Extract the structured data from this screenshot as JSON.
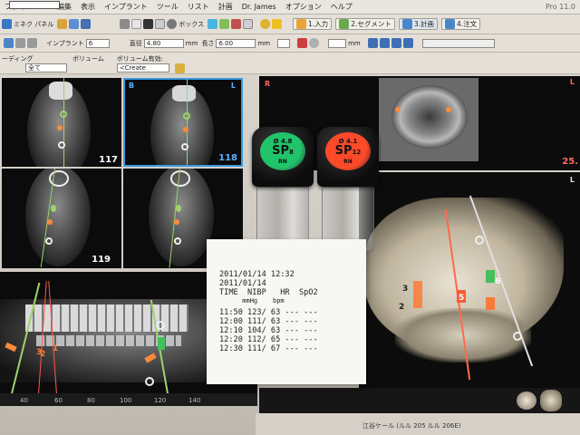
{
  "menu": {
    "window_title": "Pro 11.0",
    "items": [
      "ファイル",
      "編集",
      "表示",
      "インプラント",
      "ツール",
      "リスト",
      "計画",
      "Dr. James",
      "オプション",
      "ヘルプ"
    ]
  },
  "toolbar": {
    "mask_label": "ミネク パネル",
    "box_label": "ボックス",
    "implant_label": "インプラント",
    "implant_value": "6",
    "diameter_label": "直径",
    "diameter_value": "4.80",
    "diameter_unit": "mm",
    "length_label": "長さ",
    "length_value": "6.00",
    "length_unit": "mm",
    "mm_label": "mm",
    "steps": [
      {
        "num": "1.",
        "label": "入力"
      },
      {
        "num": "2.",
        "label": "セグメント"
      },
      {
        "num": "3.",
        "label": "計画"
      },
      {
        "num": "4.",
        "label": "注文"
      }
    ],
    "row3_label1": "ーディング",
    "row3_label2": "ボリューム",
    "row3_label3": "ボリューム有効:",
    "row3_select": "全て",
    "row3_create": "<Create"
  },
  "viewport": {
    "cross_labels": [
      "117",
      "118",
      "119"
    ],
    "tag_b": "B",
    "tag_l1": "L",
    "tag_l2": "L",
    "tag_r": "R",
    "tag_l3": "L",
    "axial_number": "25.",
    "tag_1": "1",
    "pano_numbers": [
      "3",
      "2",
      "1"
    ],
    "pano_markers": [
      "6",
      "5",
      "3",
      "2"
    ],
    "ruler_ticks": [
      "40",
      "60",
      "80",
      "100",
      "120",
      "140"
    ],
    "bottom_right_number": "-1"
  },
  "bottles": [
    {
      "line1": "Ø 4.8",
      "brand": "SP",
      "size": "8",
      "line3": "RN",
      "color": "#21c46a"
    },
    {
      "line1": "Ø 4.1",
      "brand": "SP",
      "size": "12",
      "line3": "RN",
      "color": "#ff4a2a"
    }
  ],
  "receipt": {
    "datetime": "2011/01/14 12:32",
    "date": "2011/01/14",
    "header1": "TIME  NIBP   HR  SpO2",
    "header2": "      mmHg    bpm",
    "rows": [
      "11:50 123/ 63 --- ---",
      "12:00 111/ 63 --- ---",
      "12:10 104/ 63 --- ---",
      "12:20 112/ 65 --- ---",
      "12:30 111/ 67 --- ---"
    ]
  },
  "status": {
    "text": "江谷ケール (ルル 205 ルル 206E)"
  }
}
